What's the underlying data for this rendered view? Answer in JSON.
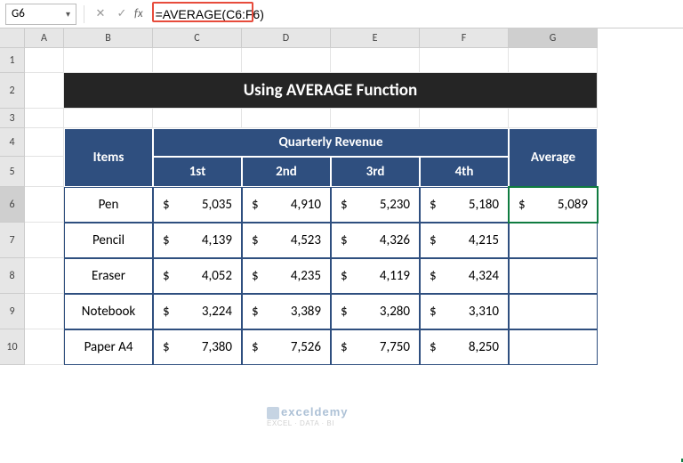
{
  "namebox": {
    "value": "G6"
  },
  "formula_bar": {
    "value": "=AVERAGE(C6:F6)"
  },
  "columns": [
    "A",
    "B",
    "C",
    "D",
    "E",
    "F",
    "G"
  ],
  "rows": [
    "1",
    "2",
    "3",
    "4",
    "5",
    "6",
    "7",
    "8",
    "9",
    "10"
  ],
  "title": "Using AVERAGE Function",
  "headers": {
    "items": "Items",
    "quarterly": "Quarterly Revenue",
    "q1": "1st",
    "q2": "2nd",
    "q3": "3rd",
    "q4": "4th",
    "average": "Average"
  },
  "currency": "$",
  "data_rows": [
    {
      "item": "Pen",
      "v": [
        "5,035",
        "4,910",
        "5,230",
        "5,180"
      ],
      "avg": "5,089"
    },
    {
      "item": "Pencil",
      "v": [
        "4,139",
        "4,523",
        "4,326",
        "4,215"
      ],
      "avg": ""
    },
    {
      "item": "Eraser",
      "v": [
        "4,052",
        "4,235",
        "4,119",
        "4,324"
      ],
      "avg": ""
    },
    {
      "item": "Notebook",
      "v": [
        "3,224",
        "3,389",
        "3,280",
        "3,310"
      ],
      "avg": ""
    },
    {
      "item": "Paper A4",
      "v": [
        "7,380",
        "7,526",
        "7,750",
        "8,250"
      ],
      "avg": ""
    }
  ],
  "watermark": {
    "brand": "exceldemy",
    "tag": "EXCEL · DATA · BI"
  },
  "chart_data": {
    "type": "table",
    "title": "Using AVERAGE Function",
    "columns": [
      "Items",
      "1st",
      "2nd",
      "3rd",
      "4th",
      "Average"
    ],
    "rows": [
      [
        "Pen",
        5035,
        4910,
        5230,
        5180,
        5089
      ],
      [
        "Pencil",
        4139,
        4523,
        4326,
        4215,
        null
      ],
      [
        "Eraser",
        4052,
        4235,
        4119,
        4324,
        null
      ],
      [
        "Notebook",
        3224,
        3389,
        3280,
        3310,
        null
      ],
      [
        "Paper A4",
        7380,
        7526,
        7750,
        8250,
        null
      ]
    ]
  }
}
